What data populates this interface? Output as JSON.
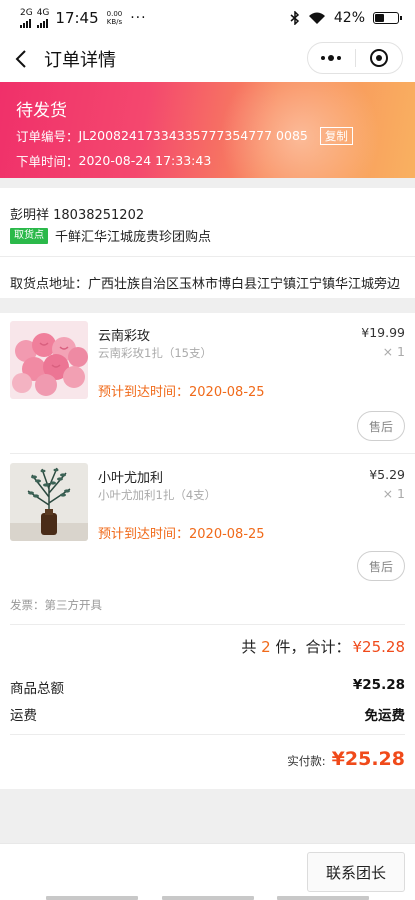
{
  "status_bar": {
    "network1": "2G",
    "network2": "4G",
    "time": "17:45",
    "speed_value": "0.00",
    "speed_unit": "KB/s",
    "more": "···",
    "battery": "42%",
    "battery_level": 0.42
  },
  "nav": {
    "title": "订单详情"
  },
  "order": {
    "status": "待发货",
    "number_label": "订单编号：",
    "number": "JL20082417334335777354777 0085",
    "copy_label": "复制",
    "time_label": "下单时间：",
    "time": "2020-08-24 17:33:43"
  },
  "contact": {
    "name_phone": "彭明祥   18038251202",
    "pickup_tag": "取货点",
    "pickup_name": "千鲜汇华江城庞贵珍团购点",
    "address": "取货点地址：广西壮族自治区玉林市博白县江宁镇江宁镇华江城旁边"
  },
  "items": [
    {
      "name": "云南彩玫",
      "spec": "云南彩玫1扎（15支）",
      "price": "¥19.99",
      "qty": "× 1",
      "eta": "预计到达时间：2020-08-25",
      "after_sale": "售后"
    },
    {
      "name": "小叶尤加利",
      "spec": "小叶尤加利1扎（4支）",
      "price": "¥5.29",
      "qty": "× 1",
      "eta": "预计到达时间：2020-08-25",
      "after_sale": "售后"
    }
  ],
  "invoice": "发票：第三方开具",
  "summary": {
    "prefix": "共 ",
    "count": "2",
    "middle": " 件，合计：",
    "amount": "¥25.28"
  },
  "totals": {
    "goods_label": "商品总额",
    "goods_value": "¥25.28",
    "shipping_label": "运费",
    "shipping_value": "免运费",
    "paid_label": "实付款:",
    "paid_value": "¥25.28"
  },
  "bottom": {
    "contact_button": "联系团长"
  },
  "colors": {
    "accent_orange": "#f06a1a",
    "price_red": "#f04a1a",
    "pickup_green": "#2bb94a"
  }
}
